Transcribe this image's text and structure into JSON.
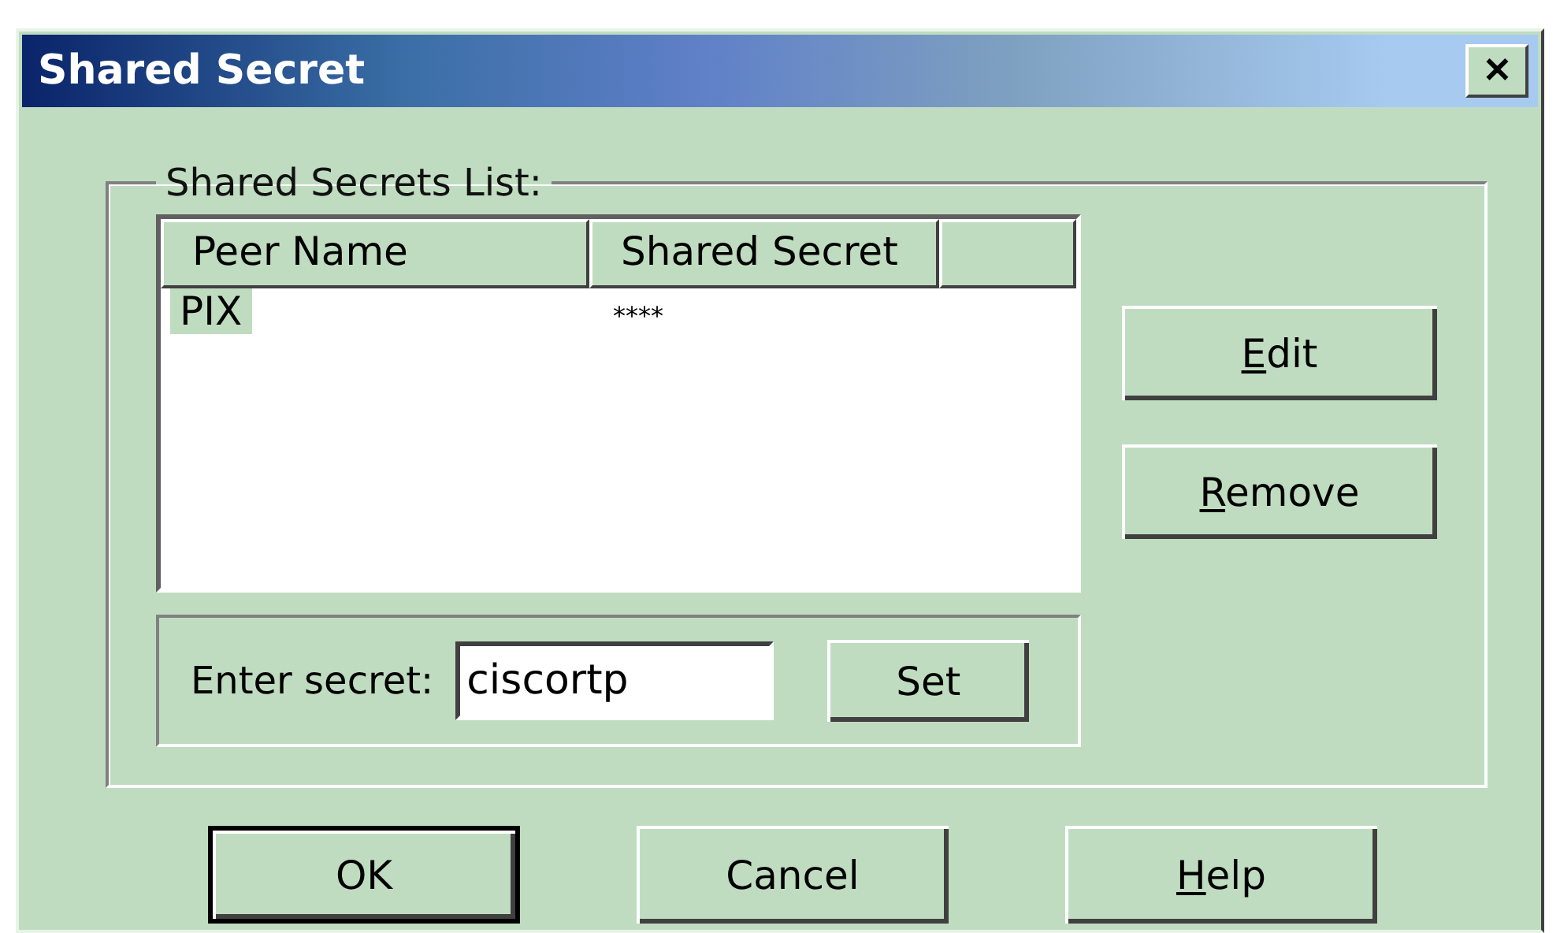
{
  "window": {
    "title": "Shared Secret",
    "close": "✕"
  },
  "group": {
    "label": "Shared Secrets List:"
  },
  "table": {
    "columns": [
      "Peer Name",
      "Shared Secret"
    ],
    "rows": [
      {
        "cells": [
          "PIX",
          "****"
        ],
        "selected": true
      }
    ]
  },
  "side_buttons": [
    {
      "label": "Edit",
      "mnemonic_first": true
    },
    {
      "label": "Remove",
      "mnemonic_first": true
    }
  ],
  "secret": {
    "label": "Enter secret:",
    "value": "ciscortp",
    "button": "Set"
  },
  "buttons": [
    {
      "label": "OK",
      "mnemonic_first": false,
      "default": true
    },
    {
      "label": "Cancel",
      "mnemonic_first": false,
      "default": false
    },
    {
      "label": "Help",
      "mnemonic_first": true,
      "default": false
    }
  ]
}
